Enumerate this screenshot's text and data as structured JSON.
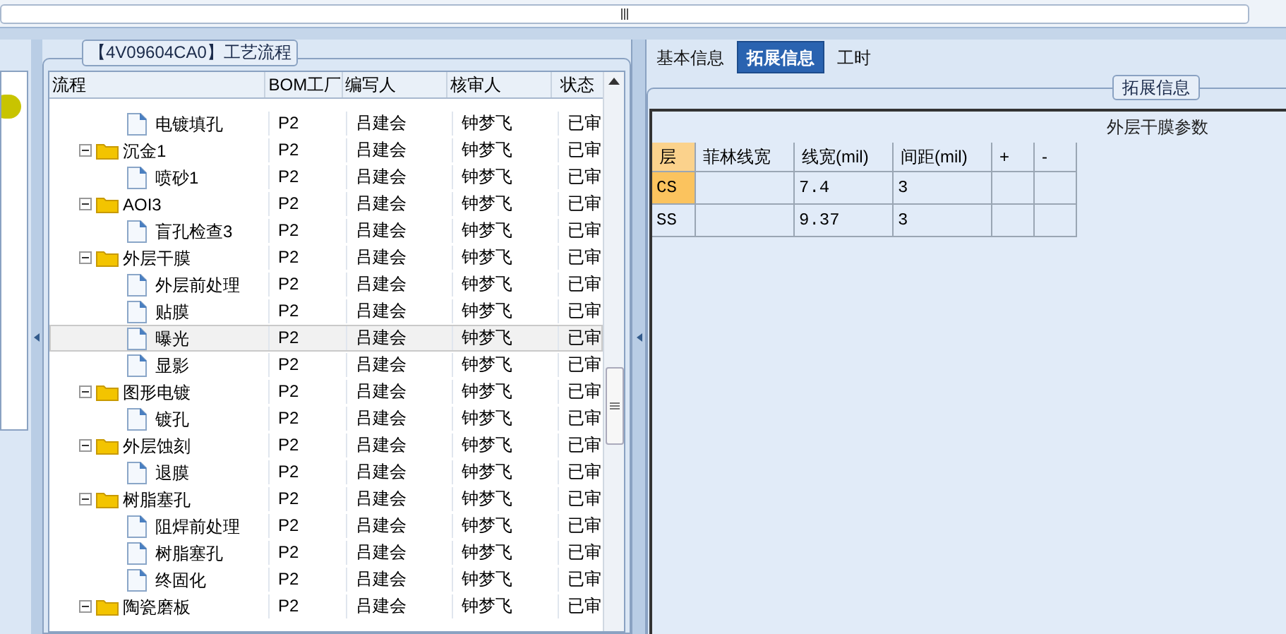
{
  "flow_panel": {
    "title": "【4V09604CA0】工艺流程",
    "columns": [
      "流程",
      "BOM工厂",
      "编写人",
      "核审人",
      "状态"
    ],
    "tree": [
      {
        "kind": "file",
        "name": "电镀填孔",
        "bom": "P2",
        "writer": "吕建会",
        "reviewer": "钟梦飞",
        "status": "已审",
        "selected": false
      },
      {
        "kind": "folder",
        "name": "沉金1",
        "bom": "P2",
        "writer": "吕建会",
        "reviewer": "钟梦飞",
        "status": "已审",
        "selected": false,
        "expanded": true,
        "children": [
          {
            "kind": "file",
            "name": "喷砂1",
            "bom": "P2",
            "writer": "吕建会",
            "reviewer": "钟梦飞",
            "status": "已审",
            "selected": false
          }
        ]
      },
      {
        "kind": "folder",
        "name": "AOI3",
        "bom": "P2",
        "writer": "吕建会",
        "reviewer": "钟梦飞",
        "status": "已审",
        "selected": false,
        "expanded": true,
        "children": [
          {
            "kind": "file",
            "name": "盲孔检查3",
            "bom": "P2",
            "writer": "吕建会",
            "reviewer": "钟梦飞",
            "status": "已审",
            "selected": false
          }
        ]
      },
      {
        "kind": "folder",
        "name": "外层干膜",
        "bom": "P2",
        "writer": "吕建会",
        "reviewer": "钟梦飞",
        "status": "已审",
        "selected": false,
        "expanded": true,
        "children": [
          {
            "kind": "file",
            "name": "外层前处理",
            "bom": "P2",
            "writer": "吕建会",
            "reviewer": "钟梦飞",
            "status": "已审",
            "selected": false
          },
          {
            "kind": "file",
            "name": "贴膜",
            "bom": "P2",
            "writer": "吕建会",
            "reviewer": "钟梦飞",
            "status": "已审",
            "selected": false
          },
          {
            "kind": "file",
            "name": "曝光",
            "bom": "P2",
            "writer": "吕建会",
            "reviewer": "钟梦飞",
            "status": "已审",
            "selected": true
          },
          {
            "kind": "file",
            "name": "显影",
            "bom": "P2",
            "writer": "吕建会",
            "reviewer": "钟梦飞",
            "status": "已审",
            "selected": false
          }
        ]
      },
      {
        "kind": "folder",
        "name": "图形电镀",
        "bom": "P2",
        "writer": "吕建会",
        "reviewer": "钟梦飞",
        "status": "已审",
        "selected": false,
        "expanded": true,
        "children": [
          {
            "kind": "file",
            "name": "镀孔",
            "bom": "P2",
            "writer": "吕建会",
            "reviewer": "钟梦飞",
            "status": "已审",
            "selected": false
          }
        ]
      },
      {
        "kind": "folder",
        "name": "外层蚀刻",
        "bom": "P2",
        "writer": "吕建会",
        "reviewer": "钟梦飞",
        "status": "已审",
        "selected": false,
        "expanded": true,
        "children": [
          {
            "kind": "file",
            "name": "退膜",
            "bom": "P2",
            "writer": "吕建会",
            "reviewer": "钟梦飞",
            "status": "已审",
            "selected": false
          }
        ]
      },
      {
        "kind": "folder",
        "name": "树脂塞孔",
        "bom": "P2",
        "writer": "吕建会",
        "reviewer": "钟梦飞",
        "status": "已审",
        "selected": false,
        "expanded": true,
        "children": [
          {
            "kind": "file",
            "name": "阻焊前处理",
            "bom": "P2",
            "writer": "吕建会",
            "reviewer": "钟梦飞",
            "status": "已审",
            "selected": false
          },
          {
            "kind": "file",
            "name": "树脂塞孔",
            "bom": "P2",
            "writer": "吕建会",
            "reviewer": "钟梦飞",
            "status": "已审",
            "selected": false
          },
          {
            "kind": "file",
            "name": "终固化",
            "bom": "P2",
            "writer": "吕建会",
            "reviewer": "钟梦飞",
            "status": "已审",
            "selected": false
          }
        ]
      },
      {
        "kind": "folder",
        "name": "陶瓷磨板",
        "bom": "P2",
        "writer": "吕建会",
        "reviewer": "钟梦飞",
        "status": "已审",
        "selected": false,
        "expanded": true
      }
    ]
  },
  "tabs": [
    {
      "label": "基本信息",
      "selected": false
    },
    {
      "label": "拓展信息",
      "selected": true
    },
    {
      "label": "工时",
      "selected": false
    }
  ],
  "ext_panel": {
    "title": "拓展信息",
    "table_title": "外层干膜参数",
    "columns": [
      "层",
      "菲林线宽",
      "线宽(mil)",
      "间距(mil)",
      "+",
      "-"
    ],
    "rows": [
      {
        "cells": [
          "CS",
          "",
          "7.4",
          "3",
          "",
          ""
        ],
        "selected": true
      },
      {
        "cells": [
          "SS",
          "",
          "9.37",
          "3",
          "",
          ""
        ],
        "selected": false
      }
    ]
  }
}
